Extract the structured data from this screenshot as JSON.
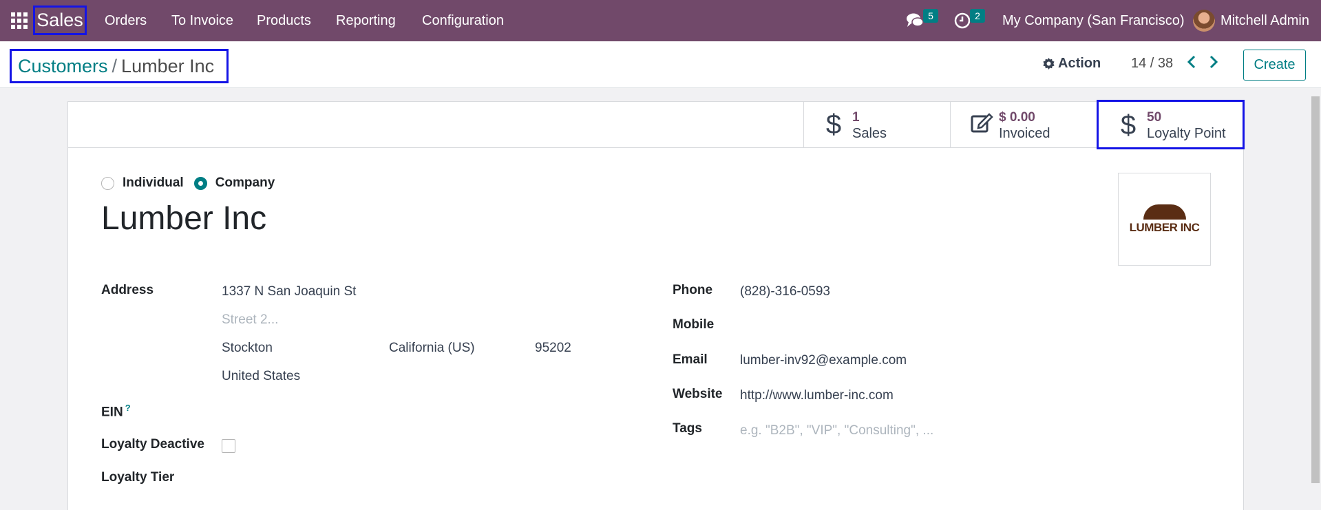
{
  "navbar": {
    "app_name": "Sales",
    "menu": [
      "Orders",
      "To Invoice",
      "Products",
      "Reporting",
      "Configuration"
    ],
    "messages_count": "5",
    "activities_count": "2",
    "company": "My Company (San Francisco)",
    "user": "Mitchell Admin"
  },
  "control_panel": {
    "breadcrumb_parent": "Customers",
    "breadcrumb_separator": "/",
    "breadcrumb_current": "Lumber Inc",
    "action_label": "Action",
    "pager": "14 / 38",
    "create_label": "Create"
  },
  "stat_buttons": [
    {
      "value": "1",
      "label": "Sales",
      "icon": "dollar-icon"
    },
    {
      "value": "$ 0.00",
      "label": "Invoiced",
      "icon": "edit-icon"
    },
    {
      "value": "50",
      "label": "Loyalty Point",
      "icon": "dollar-icon"
    }
  ],
  "partner": {
    "type_options": [
      "Individual",
      "Company"
    ],
    "type_selected": "Company",
    "name": "Lumber Inc",
    "logo_text": "LUMBER INC"
  },
  "address": {
    "label": "Address",
    "street": "1337 N San Joaquin St",
    "street2_placeholder": "Street 2...",
    "city": "Stockton",
    "state": "California (US)",
    "zip": "95202",
    "country": "United States"
  },
  "left_fields": {
    "ein_label": "EIN",
    "ein_help": "?",
    "loyalty_deactive_label": "Loyalty Deactive",
    "loyalty_tier_label": "Loyalty Tier"
  },
  "right_fields": {
    "phone_label": "Phone",
    "phone": "(828)-316-0593",
    "mobile_label": "Mobile",
    "email_label": "Email",
    "email": "lumber-inv92@example.com",
    "website_label": "Website",
    "website": "http://www.lumber-inc.com",
    "tags_label": "Tags",
    "tags_placeholder": "e.g. \"B2B\", \"VIP\", \"Consulting\", ..."
  },
  "colors": {
    "navbar": "#71496a",
    "accent": "#017e84",
    "highlight_box": "#1414e6"
  }
}
